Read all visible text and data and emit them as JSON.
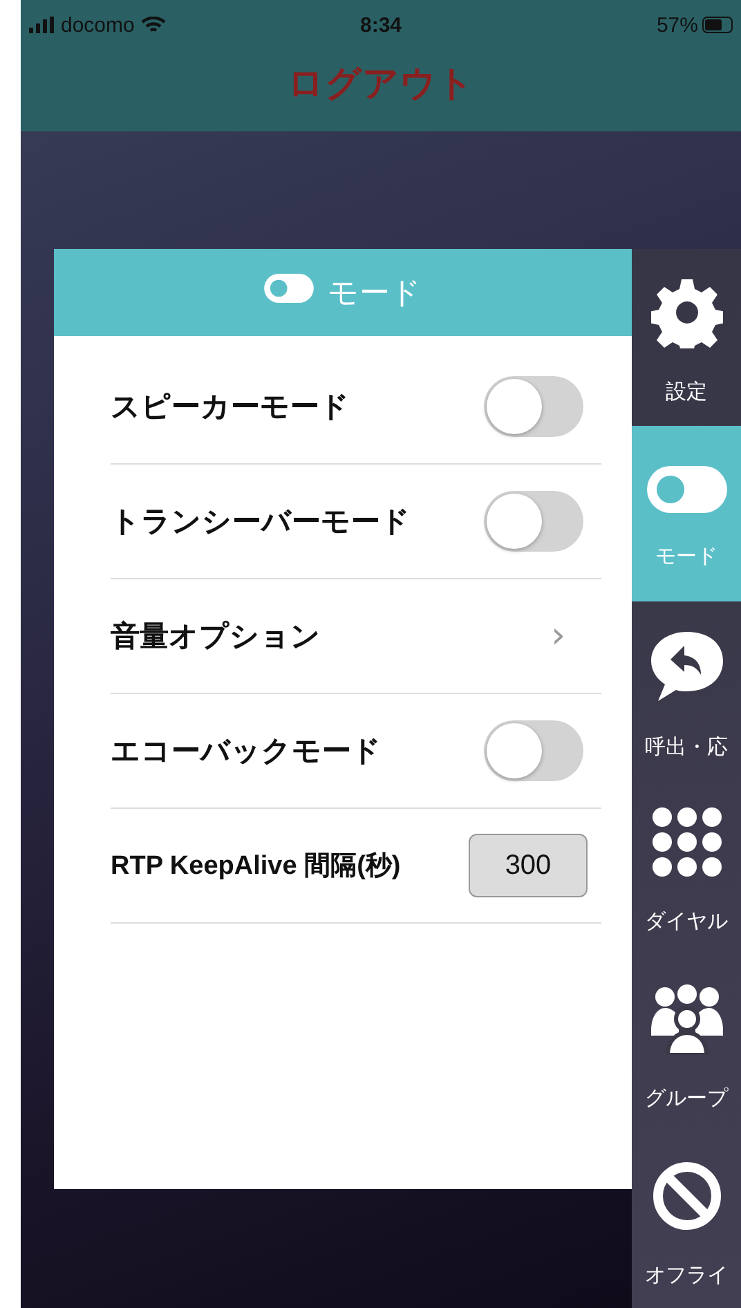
{
  "status_bar": {
    "carrier": "docomo",
    "time": "8:34",
    "battery": "57%"
  },
  "header": {
    "title": "ログアウト"
  },
  "panel": {
    "title": "モード",
    "rows": [
      {
        "kind": "toggle",
        "label": "スピーカーモード",
        "on": false
      },
      {
        "kind": "toggle",
        "label": "トランシーバーモード",
        "on": false
      },
      {
        "kind": "link",
        "label": "音量オプション",
        "chevron": "›"
      },
      {
        "kind": "toggle",
        "label": "エコーバックモード",
        "on": false
      },
      {
        "kind": "number",
        "label": "RTP KeepAlive 間隔(秒)",
        "value": "300"
      }
    ]
  },
  "sidebar": {
    "items": [
      {
        "label": "設定",
        "selected": false
      },
      {
        "label": "モード",
        "selected": true
      },
      {
        "label": "呼出・応",
        "selected": false
      },
      {
        "label": "ダイヤル",
        "selected": false
      },
      {
        "label": "グループ",
        "selected": false
      },
      {
        "label": "オフライ",
        "selected": false
      }
    ]
  }
}
